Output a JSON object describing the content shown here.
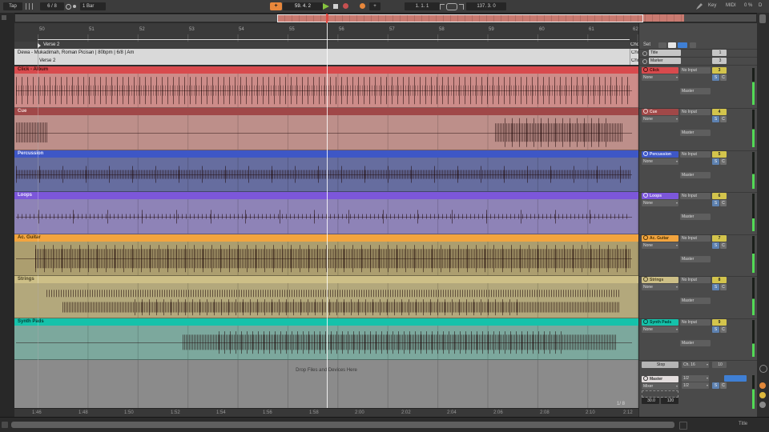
{
  "toolbar": {
    "tap": "Tap",
    "time_sig": "6 / 8",
    "quantize": "1 Bar",
    "position": "59. 4. 2",
    "loop_start": "1. 1. 1",
    "loop_length": "137. 3. 0",
    "key": "Key",
    "midi": "MIDI",
    "cpu": "0 %",
    "disk": "D"
  },
  "ruler": {
    "bars": [
      "50",
      "51",
      "52",
      "53",
      "54",
      "55",
      "56",
      "57",
      "58",
      "59",
      "60",
      "61",
      "62"
    ],
    "grid": "1/ 8"
  },
  "time_labels": [
    "1:46",
    "1:48",
    "1:50",
    "1:52",
    "1:54",
    "1:56",
    "1:58",
    "2:00",
    "2:02",
    "2:04",
    "2:06",
    "2:08",
    "2:10",
    "2:12"
  ],
  "locators": {
    "current": "Verse 2",
    "next": "Chorus"
  },
  "set_panel": {
    "label": "Set"
  },
  "info_tracks": [
    {
      "panel": "Title",
      "number": "1",
      "clip": "Dewa - Mukadimah, Roman Picisan | 80bpm | 6/8 | Am",
      "clip_right": "Chorus"
    },
    {
      "panel": "Marker",
      "number": "3",
      "clip": "Verse 2",
      "clip_right": "Chorus"
    }
  ],
  "tracks": [
    {
      "name": "Click - Album",
      "panel": "Click",
      "head": "#d84a4d",
      "body": "#cd8c89",
      "text": "#44100f",
      "input": "No Input",
      "channel": "None",
      "output": "Master",
      "number": "3",
      "solo": "S",
      "cross": "C"
    },
    {
      "name": "Cue",
      "panel": "Cue",
      "head": "#a04848",
      "body": "#bd8f8a",
      "text": "#f2d7d5",
      "input": "No Input",
      "channel": "None",
      "output": "Master",
      "number": "4",
      "solo": "S",
      "cross": "C"
    },
    {
      "name": "Percussion",
      "panel": "Percussion",
      "head": "#3e57c6",
      "body": "#666d9f",
      "text": "#e2e7ff",
      "input": "No Input",
      "channel": "None",
      "output": "Master",
      "number": "5",
      "solo": "S",
      "cross": "C"
    },
    {
      "name": "Loops",
      "panel": "Loops",
      "head": "#7c57da",
      "body": "#8e83b7",
      "text": "#eae4ff",
      "input": "No Input",
      "channel": "None",
      "output": "Master",
      "number": "6",
      "solo": "S",
      "cross": "C"
    },
    {
      "name": "Ac. Guitar",
      "panel": "Ac. Guitar",
      "head": "#f2a43e",
      "body": "#ac9e6f",
      "text": "#4c3305",
      "input": "No Input",
      "channel": "None",
      "output": "Master",
      "number": "7",
      "solo": "S",
      "cross": "C"
    },
    {
      "name": "Strings",
      "panel": "Strings",
      "head": "#cdbf87",
      "body": "#b3a87c",
      "text": "#4b4226",
      "input": "No Input",
      "channel": "None",
      "output": "Master",
      "number": "8",
      "solo": "S",
      "cross": "C"
    },
    {
      "name": "Synth Pads",
      "panel": "Synth Pads",
      "head": "#15c2aa",
      "body": "#7ca89d",
      "text": "#043d35",
      "input": "No Input",
      "channel": "None",
      "output": "Master",
      "number": "9",
      "solo": "S",
      "cross": "C"
    }
  ],
  "drop_zone": "Drop Files and Devices Here",
  "stop_row": {
    "stop": "Stop",
    "channel": "Ch. 16",
    "number": "10"
  },
  "master": {
    "name": "Master",
    "mixer": "Mixer",
    "out_a": "1/2",
    "out_b": "1/2",
    "val_a": "30.0",
    "val_b": "120",
    "solo": "S",
    "cross": "C"
  },
  "status": {
    "title": "Title"
  },
  "colors": {
    "accent_orange": "#e8873b",
    "play_green": "#86c43e",
    "record_red": "#c75050",
    "select_blue": "#3f7fd4",
    "meter_green": "#52d955"
  }
}
